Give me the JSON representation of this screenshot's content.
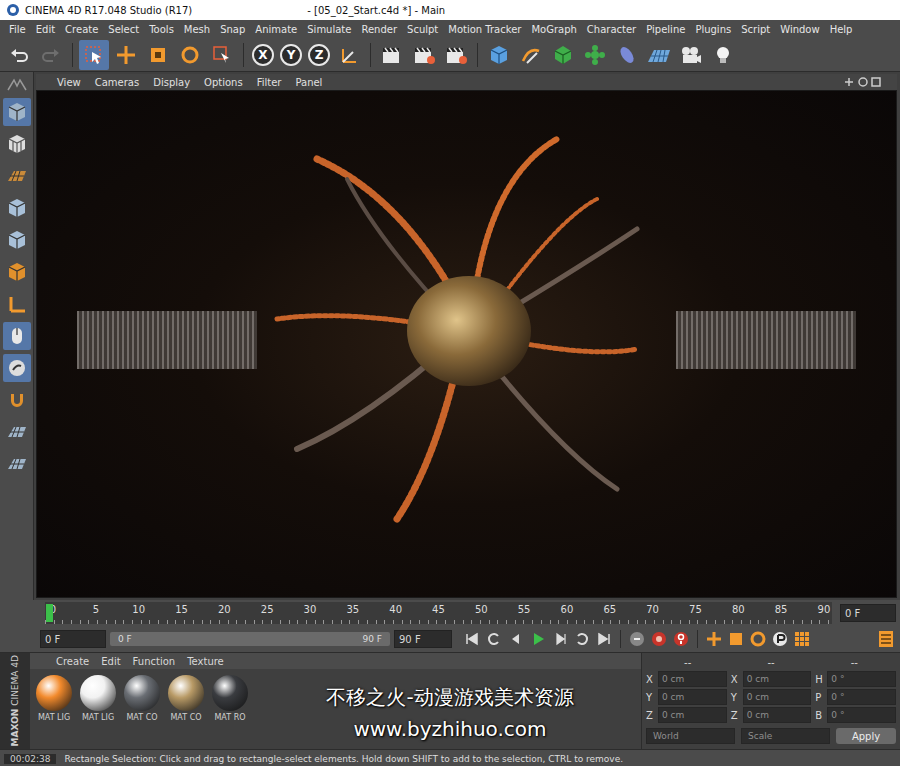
{
  "window": {
    "app_title": "CINEMA 4D R17.048 Studio (R17)",
    "document_title": "- [05_02_Start.c4d *] - Main"
  },
  "menu": [
    "File",
    "Edit",
    "Create",
    "Select",
    "Tools",
    "Mesh",
    "Snap",
    "Animate",
    "Simulate",
    "Render",
    "Sculpt",
    "Motion Tracker",
    "MoGraph",
    "Character",
    "Pipeline",
    "Plugins",
    "Script",
    "Window",
    "Help"
  ],
  "toolbar": {
    "axis_buttons": [
      {
        "label": "X",
        "on": true
      },
      {
        "label": "Y",
        "on": true
      },
      {
        "label": "Z",
        "on": true
      }
    ]
  },
  "viewport": {
    "menu": [
      "View",
      "Cameras",
      "Display",
      "Options",
      "Filter",
      "Panel"
    ]
  },
  "timeline": {
    "ticks": [
      "0",
      "5",
      "10",
      "15",
      "20",
      "25",
      "30",
      "35",
      "40",
      "45",
      "50",
      "55",
      "60",
      "65",
      "70",
      "75",
      "80",
      "85",
      "90"
    ],
    "current_frame": "0 F",
    "playhead_level": 0
  },
  "playback": {
    "start": "0 F",
    "range_start": "0 F",
    "range_end": "90 F",
    "end": "90 F"
  },
  "materials": {
    "menu": [
      "Create",
      "Edit",
      "Function",
      "Texture"
    ],
    "items": [
      {
        "name": "MAT LIG",
        "color": "#f28a2c"
      },
      {
        "name": "MAT LIG",
        "color": "#f2f2f2"
      },
      {
        "name": "MAT CO",
        "color": "#6a6e74"
      },
      {
        "name": "MAT CO",
        "color": "#b89a66"
      },
      {
        "name": "MAT RO",
        "color": "#3a3c40"
      }
    ]
  },
  "coordinates": {
    "headers": [
      "--",
      "--",
      "--"
    ],
    "rows": [
      [
        {
          "axis": "X",
          "value": "0 cm"
        },
        {
          "axis": "X",
          "value": "0 cm"
        },
        {
          "axis": "H",
          "value": "0 °"
        }
      ],
      [
        {
          "axis": "Y",
          "value": "0 cm"
        },
        {
          "axis": "Y",
          "value": "0 cm"
        },
        {
          "axis": "P",
          "value": "0 °"
        }
      ],
      [
        {
          "axis": "Z",
          "value": "0 cm"
        },
        {
          "axis": "Z",
          "value": "0 cm"
        },
        {
          "axis": "B",
          "value": "0 °"
        }
      ]
    ],
    "dropdowns": [
      "World",
      "Scale"
    ],
    "apply": "Apply"
  },
  "logo": {
    "brand": "MAXON",
    "product": "CINEMA 4D"
  },
  "status_bar": {
    "time": "00:02:38",
    "message": "Rectangle Selection: Click and drag to rectangle-select elements. Hold down SHIFT to add to the selection, CTRL to remove."
  },
  "watermark": {
    "line1": "不移之火-动漫游戏美术资源",
    "line2": "www.byzhihuo.com"
  }
}
